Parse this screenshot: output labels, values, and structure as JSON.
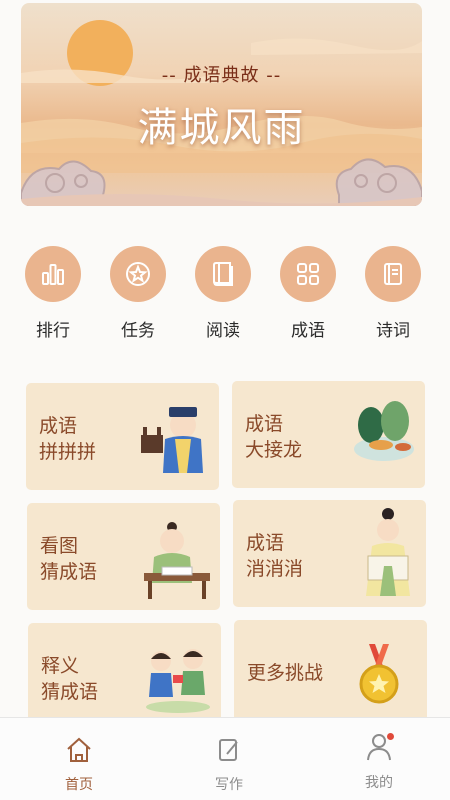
{
  "banner": {
    "subtitle": "-- 成语典故 --",
    "title": "满城风雨"
  },
  "quick_nav": [
    {
      "label": "排行",
      "icon": "bar-chart-icon"
    },
    {
      "label": "任务",
      "icon": "star-badge-icon"
    },
    {
      "label": "阅读",
      "icon": "book-icon"
    },
    {
      "label": "成语",
      "icon": "grid-icon"
    },
    {
      "label": "诗词",
      "icon": "notebook-icon"
    }
  ],
  "cards": [
    {
      "line1": "成语",
      "line2": "拼拼拼",
      "art": "scholar-illustration"
    },
    {
      "line1": "成语",
      "line2": "大接龙",
      "art": "landscape-illustration"
    },
    {
      "line1": "看图",
      "line2": "猜成语",
      "art": "reading-child-illustration"
    },
    {
      "line1": "成语",
      "line2": "消消消",
      "art": "girl-scroll-illustration"
    },
    {
      "line1": "释义",
      "line2": "猜成语",
      "art": "two-kids-illustration"
    },
    {
      "line1": "更多挑战",
      "line2": "",
      "art": "medal-illustration"
    }
  ],
  "tabbar": {
    "items": [
      {
        "label": "首页",
        "icon": "home-icon",
        "active": true
      },
      {
        "label": "写作",
        "icon": "write-icon",
        "active": false
      },
      {
        "label": "我的",
        "icon": "user-icon",
        "active": false
      }
    ],
    "colors": {
      "active": "#a0603c",
      "inactive": "#8c8c8c"
    }
  },
  "colors": {
    "accent": "#eab48e",
    "card_bg": "#f6e7cf",
    "card_text": "#8a4a2a"
  }
}
